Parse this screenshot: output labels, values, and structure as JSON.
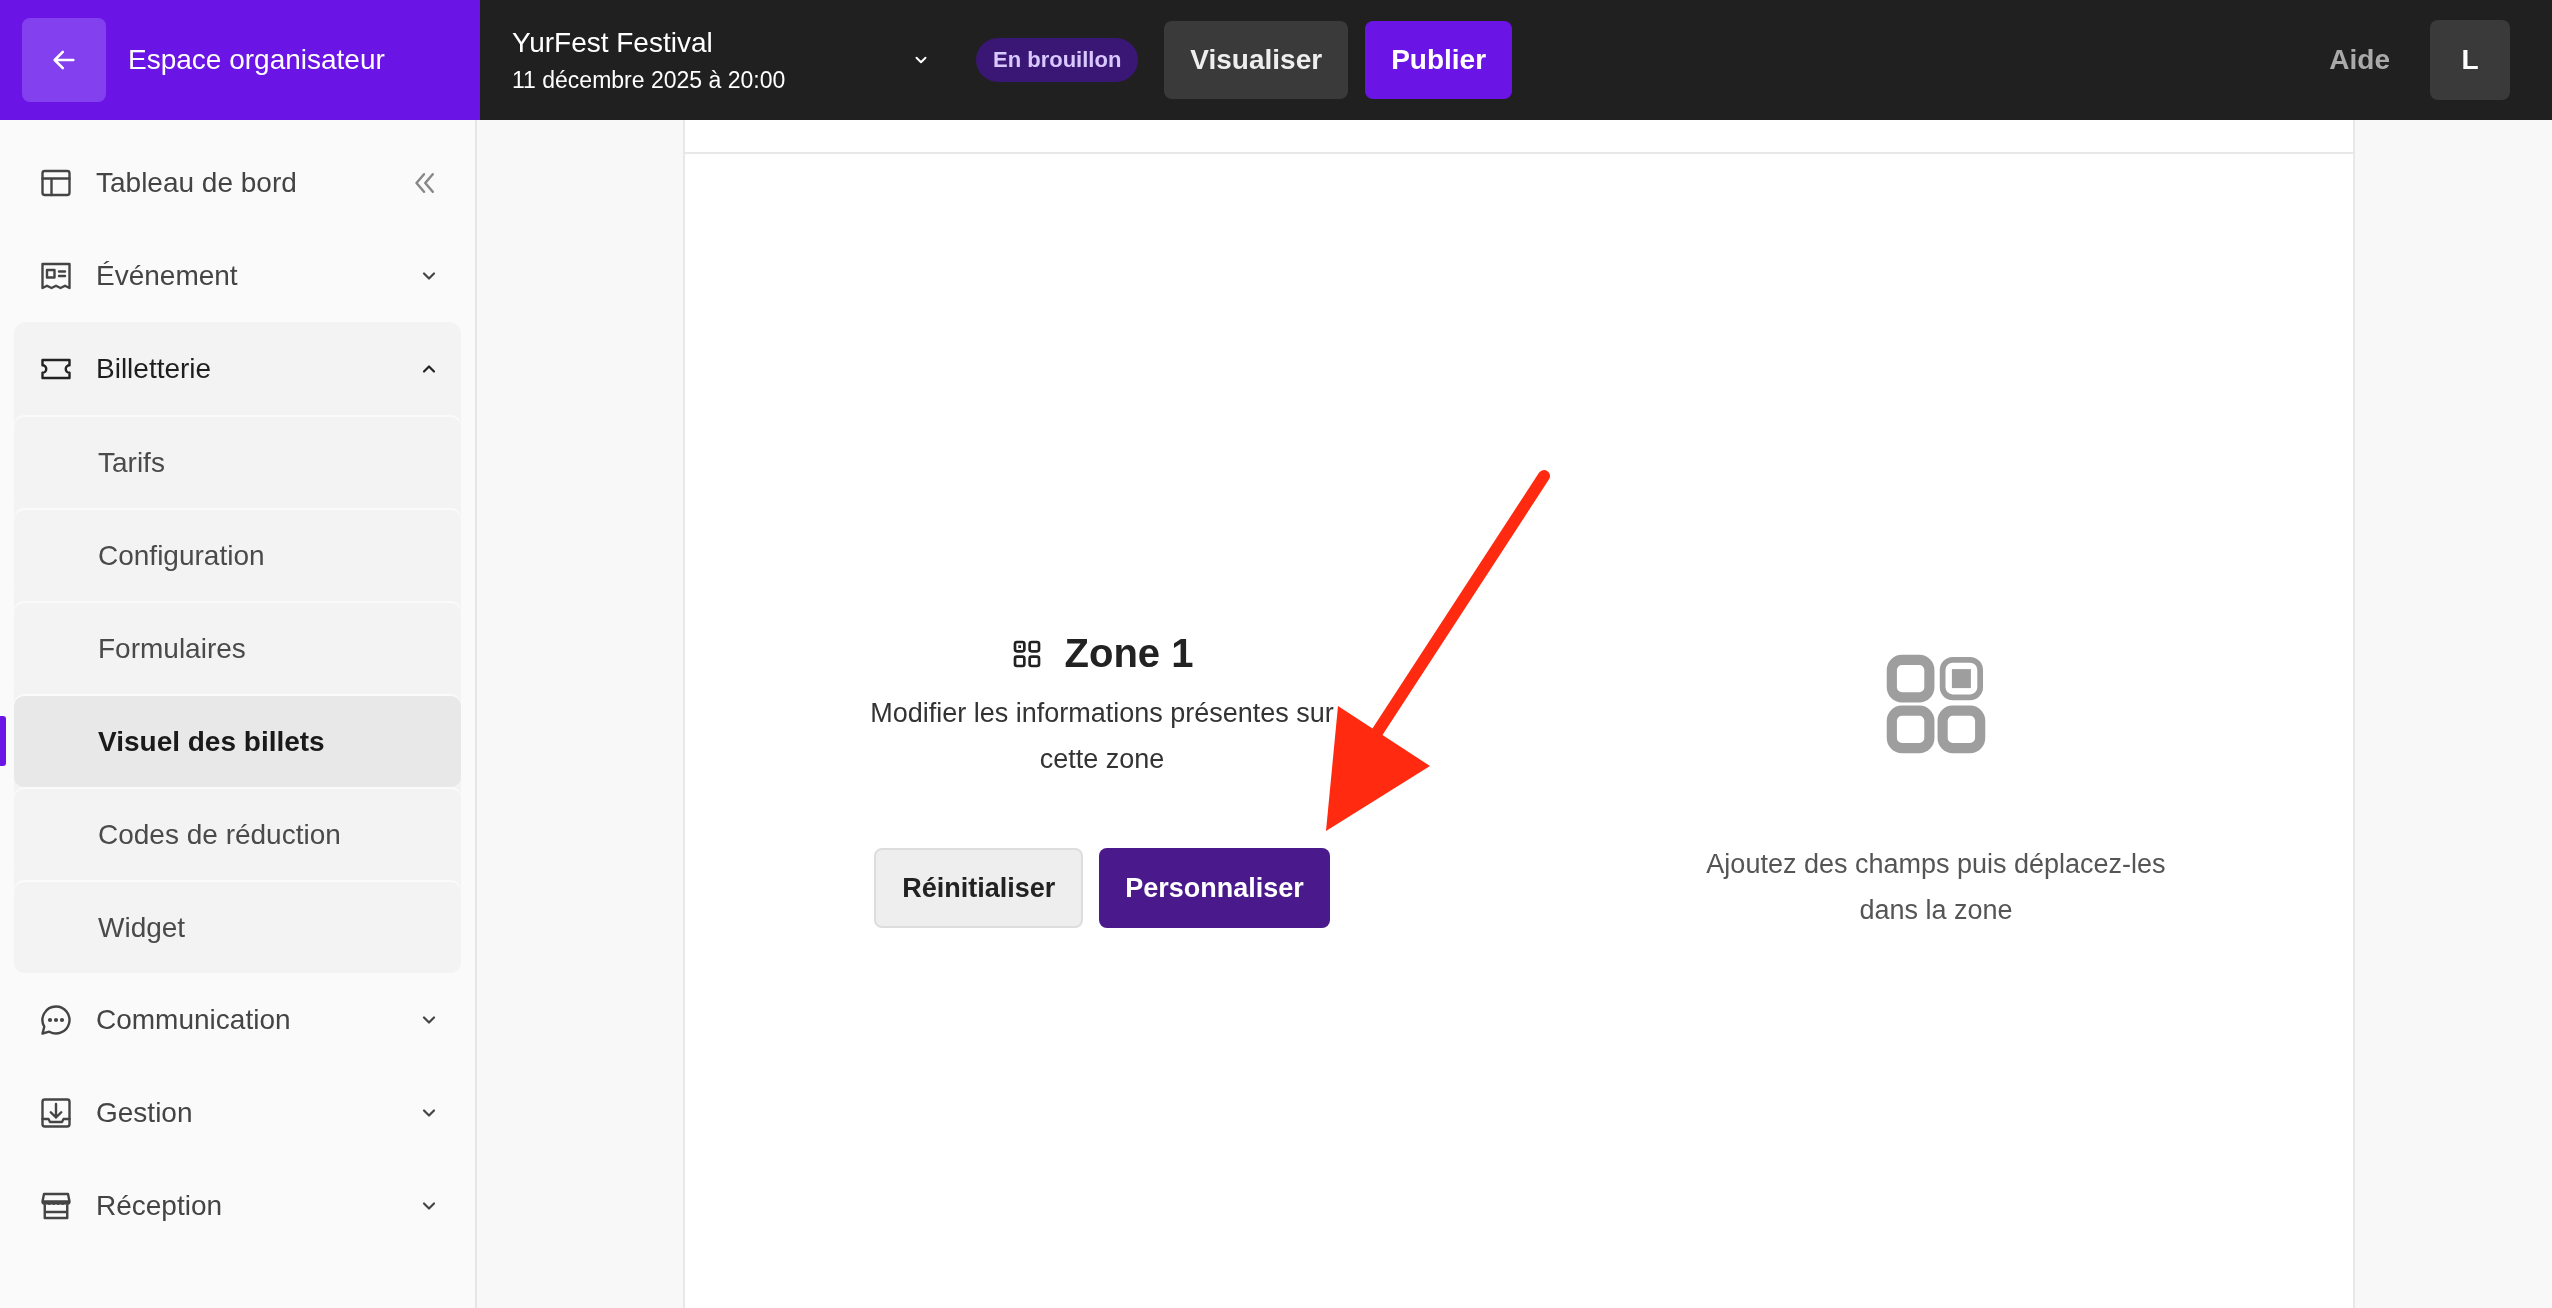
{
  "header": {
    "back_label": "Espace organisateur",
    "event": {
      "title": "YurFest Festival",
      "date": "11 décembre 2025 à 20:00"
    },
    "status": "En brouillon",
    "buttons": [
      {
        "label": "Visualiser",
        "kind": "secondary"
      },
      {
        "label": "Publier",
        "kind": "primary"
      }
    ],
    "help": "Aide",
    "avatar": "L"
  },
  "sidebar": {
    "items": [
      {
        "label": "Tableau de bord",
        "kind": "link"
      },
      {
        "label": "Événement",
        "kind": "group",
        "expanded": false
      },
      {
        "label": "Billetterie",
        "kind": "group",
        "expanded": true,
        "children": [
          {
            "label": "Tarifs",
            "selected": false
          },
          {
            "label": "Configuration",
            "selected": false
          },
          {
            "label": "Formulaires",
            "selected": false
          },
          {
            "label": "Visuel des billets",
            "selected": true
          },
          {
            "label": "Codes de réduction",
            "selected": false
          },
          {
            "label": "Widget",
            "selected": false
          }
        ]
      },
      {
        "label": "Communication",
        "kind": "group",
        "expanded": false
      },
      {
        "label": "Gestion",
        "kind": "group",
        "expanded": false
      },
      {
        "label": "Réception",
        "kind": "group",
        "expanded": false
      }
    ]
  },
  "zone": {
    "title": "Zone 1",
    "description": "Modifier les informations présentes sur cette zone",
    "buttons": [
      {
        "label": "Réinitialiser",
        "kind": "secondary"
      },
      {
        "label": "Personnaliser",
        "kind": "primary"
      }
    ]
  },
  "drop_hint": "Ajoutez des champs puis déplacez-les dans la zone"
}
